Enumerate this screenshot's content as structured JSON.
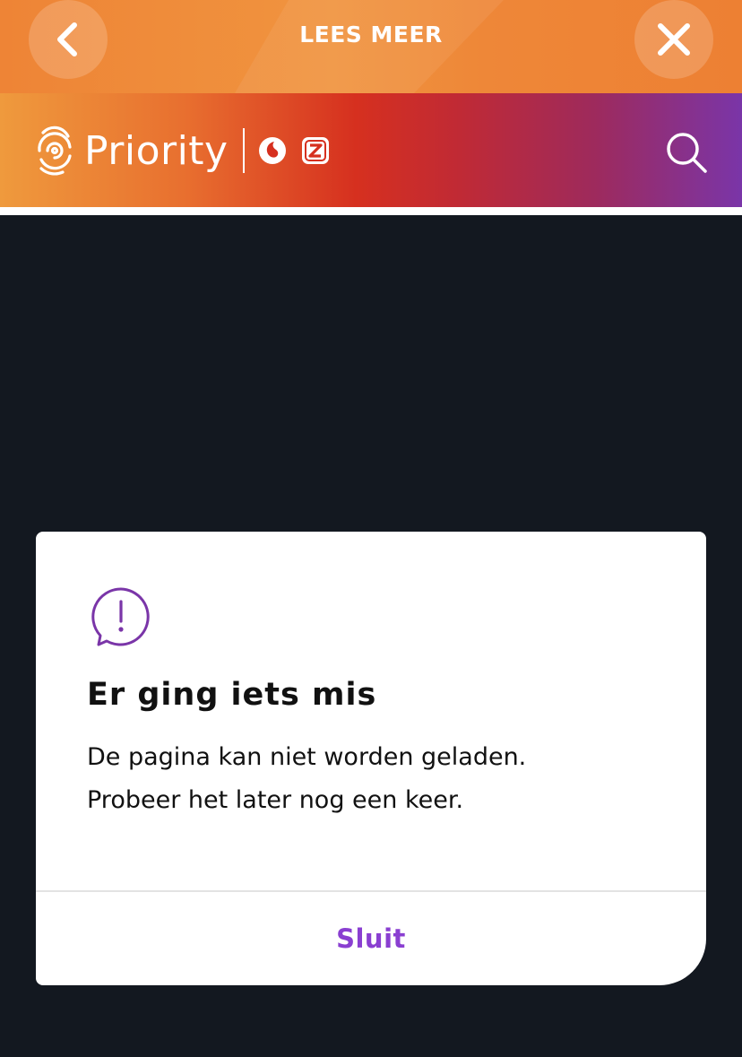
{
  "topbar": {
    "title": "LEES MEER",
    "back_icon": "chevron-left-icon",
    "close_icon": "close-icon"
  },
  "brand": {
    "name": "Priority",
    "logo_icon": "fingerprint-icon",
    "partner_icons": [
      "vodafone-icon",
      "ziggo-icon"
    ],
    "search_icon": "search-icon"
  },
  "dialog": {
    "icon": "alert-speech-bubble-icon",
    "title": "Er ging iets mis",
    "body_line1": "De pagina kan niet worden geladen.",
    "body_line2": "Probeer het later nog een keer.",
    "button_label": "Sluit"
  },
  "colors": {
    "accent_purple": "#8a3fd1",
    "topbar_orange": "#ee8436",
    "background": "#131820"
  }
}
